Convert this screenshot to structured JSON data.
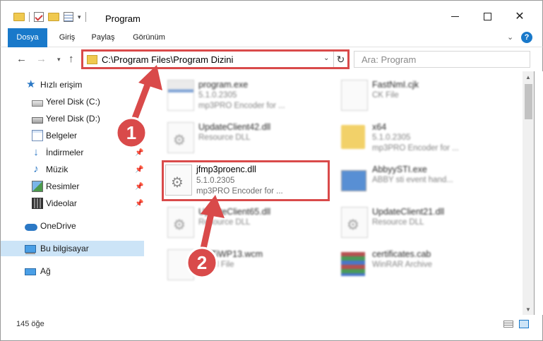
{
  "window": {
    "title": "Program",
    "minimize_icon": "minimize-icon",
    "maximize_icon": "maximize-icon",
    "close_icon": "close-icon",
    "close_glyph": "✕"
  },
  "quick_access_toolbar": {
    "dropdown_glyph": "▾"
  },
  "ribbon": {
    "tabs": [
      {
        "label": "Dosya",
        "active": true
      },
      {
        "label": "Giriş"
      },
      {
        "label": "Paylaş"
      },
      {
        "label": "Görünüm"
      }
    ],
    "expand_glyph": "⌄",
    "help_glyph": "?"
  },
  "navigation": {
    "back_glyph": "←",
    "forward_glyph": "→",
    "recent_glyph": "▾",
    "up_glyph": "↑"
  },
  "address_bar": {
    "path": "C:\\Program Files\\Program Dizini",
    "dropdown_glyph": "⌄",
    "refresh_glyph": "↻"
  },
  "search": {
    "placeholder": "Ara: Program"
  },
  "sidebar": {
    "items": [
      {
        "label": "Hızlı erişim",
        "icon": "star-icon"
      },
      {
        "label": "Yerel Disk (C:)",
        "icon": "drive-icon"
      },
      {
        "label": "Yerel Disk (D:)",
        "icon": "drive-icon"
      },
      {
        "label": "Belgeler",
        "icon": "documents-icon"
      },
      {
        "label": "İndirmeler",
        "icon": "downloads-icon",
        "pinned": true
      },
      {
        "label": "Müzik",
        "icon": "music-icon",
        "pinned": true
      },
      {
        "label": "Resimler",
        "icon": "pictures-icon",
        "pinned": true
      },
      {
        "label": "Videolar",
        "icon": "videos-icon",
        "pinned": true
      },
      {
        "label": "OneDrive",
        "icon": "onedrive-icon"
      },
      {
        "label": "Bu bilgisayar",
        "icon": "this-pc-icon",
        "selected": true
      },
      {
        "label": "Ağ",
        "icon": "network-icon"
      }
    ],
    "pin_glyph": "📌"
  },
  "files": [
    {
      "name": "program.exe",
      "version": "5.1.0.2305",
      "description": "mp3PRO Encoder for ...",
      "icon": "exe-file-icon"
    },
    {
      "name": "FastNmI.cjk",
      "version": "CK File",
      "description": "",
      "icon": "generic-file-icon"
    },
    {
      "name": "UpdateClient42.dll",
      "version": "Resource DLL",
      "description": "",
      "icon": "dll-file-icon"
    },
    {
      "name": "x64",
      "version": "5.1.0.2305",
      "description": "mp3PRO Encoder for ...",
      "icon": "folder-icon"
    },
    {
      "name": "jfmp3proenc.dll",
      "version": "5.1.0.2305",
      "description": "mp3PRO Encoder for ...",
      "icon": "dll-file-icon",
      "highlighted": true
    },
    {
      "name": "AbbyySTI.exe",
      "version": "ABBY sti event hand...",
      "description": "",
      "icon": "app-file-icon"
    },
    {
      "name": "UpdateClient65.dll",
      "version": "Resource DLL",
      "description": "",
      "icon": "dll-file-icon"
    },
    {
      "name": "UpdateClient21.dll",
      "version": "Resource DLL",
      "description": "",
      "icon": "dll-file-icon"
    },
    {
      "name": "AsfTiWP13.wcm",
      "version": "WCM File",
      "description": "",
      "icon": "generic-file-icon"
    },
    {
      "name": "certificates.cab",
      "version": "WinRAR Archive",
      "description": "",
      "icon": "archive-icon"
    }
  ],
  "annotations": [
    {
      "number": "1",
      "color": "#d94a4a"
    },
    {
      "number": "2",
      "color": "#d94a4a"
    }
  ],
  "scrollbar": {
    "up_glyph": "▲",
    "down_glyph": "▼"
  },
  "status_bar": {
    "item_count": "145 öğe"
  },
  "colors": {
    "accent": "#1979ca",
    "highlight_border": "#d94a4a",
    "selected_nav": "#cce4f7"
  }
}
